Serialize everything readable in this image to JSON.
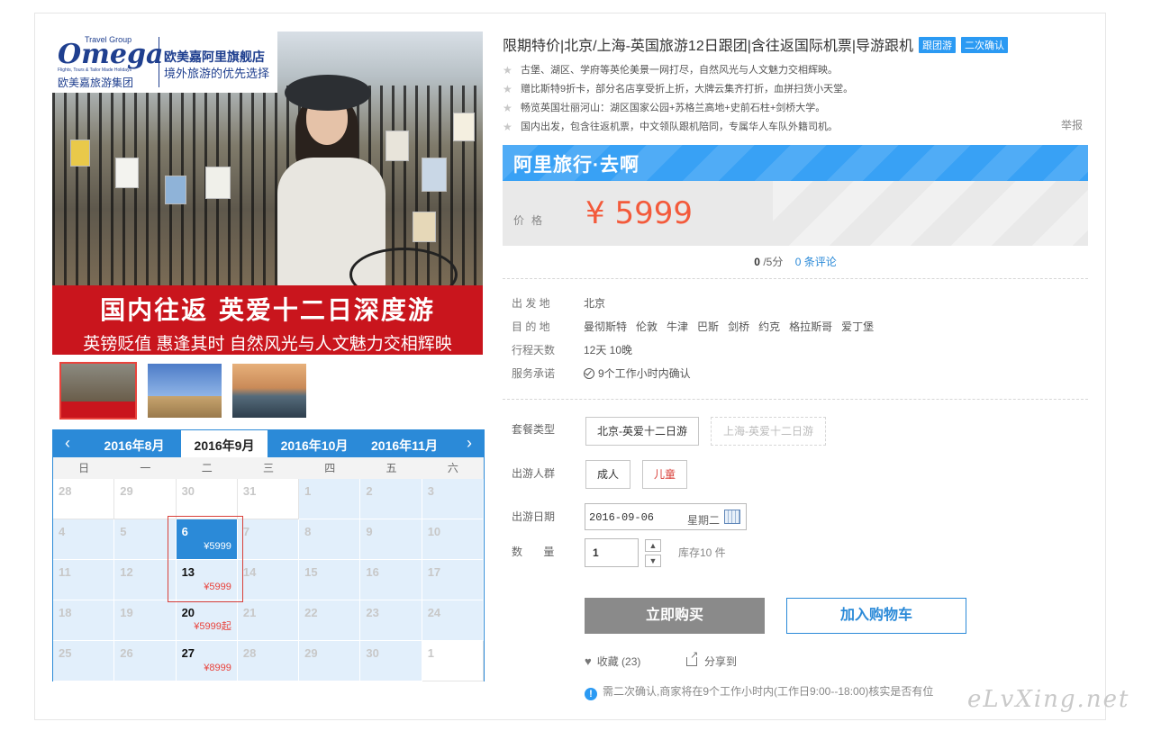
{
  "gallery": {
    "logo_word": "Omega",
    "logo_small": "Travel Group",
    "logo_tagline": "Flights, Tours & Tailor Made Holidays",
    "logo_cn": "欧美嘉旅游集团",
    "brand_line1": "欧美嘉阿里旗舰店",
    "brand_line2": "境外旅游的优先选择",
    "banner_main": "国内往返 英爱十二日深度游",
    "banner_sub": "英镑贬值 惠逢其时 自然风光与人文魅力交相辉映",
    "thumbnails": [
      "thumb-cover",
      "thumb-big-ben",
      "thumb-london-skyline"
    ]
  },
  "calendar": {
    "prev_icon": "chevron-left-icon",
    "next_icon": "chevron-right-icon",
    "months": [
      "2016年8月",
      "2016年9月",
      "2016年10月",
      "2016年11月"
    ],
    "active_month": "2016年9月",
    "weekdays": [
      "日",
      "一",
      "二",
      "三",
      "四",
      "五",
      "六"
    ],
    "days": [
      {
        "d": "28",
        "out": true
      },
      {
        "d": "29",
        "out": true
      },
      {
        "d": "30",
        "out": true
      },
      {
        "d": "31",
        "out": true
      },
      {
        "d": "1"
      },
      {
        "d": "2"
      },
      {
        "d": "3"
      },
      {
        "d": "4"
      },
      {
        "d": "5"
      },
      {
        "d": "6",
        "price": "¥5999",
        "avail": true,
        "selected": true
      },
      {
        "d": "7"
      },
      {
        "d": "8"
      },
      {
        "d": "9"
      },
      {
        "d": "10"
      },
      {
        "d": "11"
      },
      {
        "d": "12"
      },
      {
        "d": "13",
        "price": "¥5999",
        "avail": true
      },
      {
        "d": "14"
      },
      {
        "d": "15"
      },
      {
        "d": "16"
      },
      {
        "d": "17"
      },
      {
        "d": "18"
      },
      {
        "d": "19"
      },
      {
        "d": "20",
        "price": "¥5999起",
        "avail": true
      },
      {
        "d": "21"
      },
      {
        "d": "22"
      },
      {
        "d": "23"
      },
      {
        "d": "24"
      },
      {
        "d": "25"
      },
      {
        "d": "26"
      },
      {
        "d": "27",
        "price": "¥8999",
        "avail": true
      },
      {
        "d": "28"
      },
      {
        "d": "29"
      },
      {
        "d": "30"
      },
      {
        "d": "1",
        "out": true
      }
    ]
  },
  "product": {
    "title": "限期特价|北京/上海-英国旅游12日跟团|含往返国际机票|导游跟机",
    "tags": [
      "跟团游",
      "二次确认"
    ],
    "features": [
      "古堡、湖区、学府等英伦美景一网打尽，自然风光与人文魅力交相辉映。",
      "赠比斯特9折卡，部分名店享受折上折，大牌云集齐打折，血拼扫货小天堂。",
      "畅览英国壮丽河山：湖区国家公园+苏格兰高地+史前石柱+剑桥大学。",
      "国内出发，包含往返机票，中文领队跟机陪同，专属华人车队外籍司机。"
    ],
    "report": "举报"
  },
  "price": {
    "band": "阿里旅行·去啊",
    "label": "价格",
    "value": "¥ 5999"
  },
  "rating": {
    "score": "0",
    "suffix": "/5分",
    "reviews": "0 条评论"
  },
  "details": {
    "departure_label": "出 发 地",
    "departure": "北京",
    "dest_label": "目 的 地",
    "destinations": [
      "曼彻斯特",
      "伦敦",
      "牛津",
      "巴斯",
      "剑桥",
      "约克",
      "格拉斯哥",
      "爱丁堡"
    ],
    "days_label": "行程天数",
    "days": "12天 10晚",
    "promise_label": "服务承诺",
    "promise": "9个工作小时内确认"
  },
  "options": {
    "package_label": "套餐类型",
    "packages": [
      "北京-英爱十二日游",
      "上海-英爱十二日游"
    ],
    "crowd_label": "出游人群",
    "crowds": [
      "成人",
      "儿童"
    ],
    "date_label": "出游日期",
    "date_value": "2016-09-06",
    "weekday": "星期二",
    "qty_label": "数 量",
    "qty_value": "1",
    "stock": "库存10 件"
  },
  "actions": {
    "buy": "立即购买",
    "cart": "加入购物车",
    "fav": "收藏 (23)",
    "share": "分享到"
  },
  "notice": "需二次确认,商家将在9个工作小时内(工作日9:00--18:00)核实是否有位",
  "watermark": "eLvXing.net",
  "colors": {
    "accent": "#2b8ad8",
    "price": "#f35a3b",
    "banner_red": "#c9151d"
  }
}
